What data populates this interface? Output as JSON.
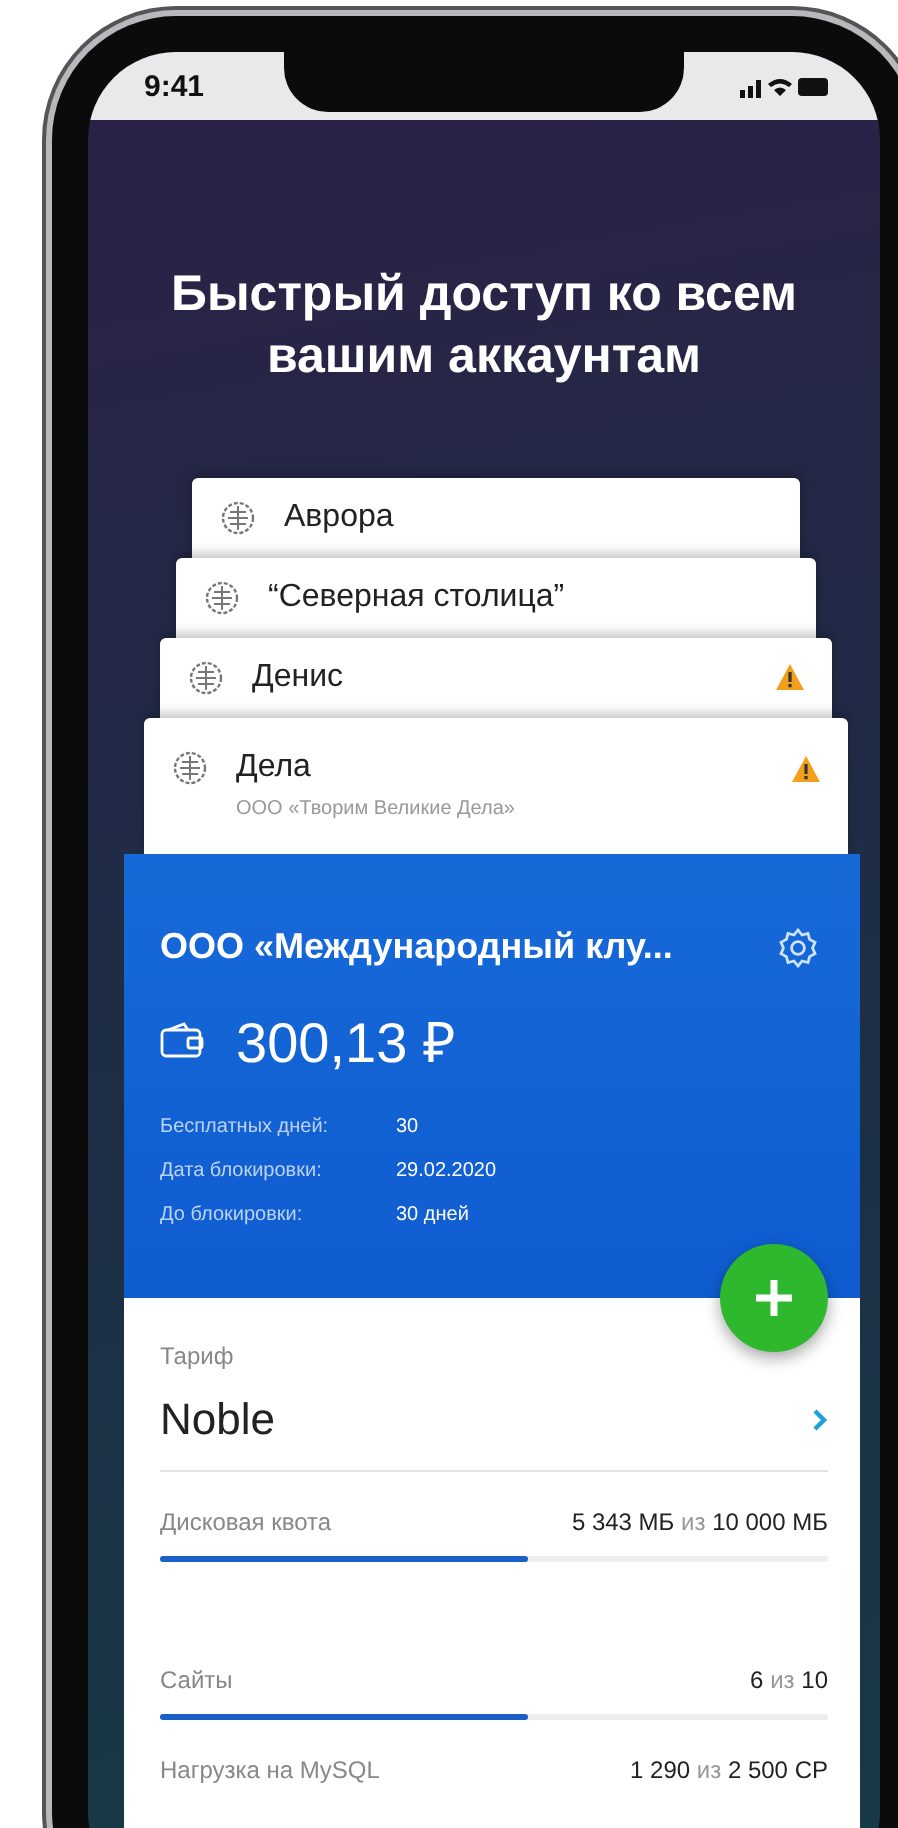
{
  "status_bar": {
    "time": "9:41"
  },
  "headline": "Быстрый доступ ко всем вашим аккаунтам",
  "accounts": [
    {
      "name": "Аврора",
      "warning": false
    },
    {
      "name": "“Северная столица”",
      "warning": false
    },
    {
      "name": "Денис",
      "warning": true
    },
    {
      "name": "Дела",
      "subtitle": "ООО «Творим Великие Дела»",
      "warning": true
    }
  ],
  "account_card": {
    "title": "ООО «Международный клу...",
    "balance": "300,13 ₽",
    "details": [
      {
        "label": "Бесплатных дней:",
        "value": "30"
      },
      {
        "label": "Дата блокировки:",
        "value": "29.02.2020"
      },
      {
        "label": "До блокировки:",
        "value": "30 дней"
      }
    ]
  },
  "tariff": {
    "label": "Тариф",
    "value": "Noble"
  },
  "usage": [
    {
      "label": "Дисковая квота",
      "used": "5 343 МБ",
      "sep": "из",
      "total": "10 000 МБ",
      "level": 0.55
    },
    {
      "label": "Сайты",
      "used": "6",
      "sep": "из",
      "total": "10",
      "level": 0.55
    },
    {
      "label": "Нагрузка на MySQL",
      "used": "1 290",
      "sep": "из",
      "total": "2 500 CP"
    }
  ]
}
